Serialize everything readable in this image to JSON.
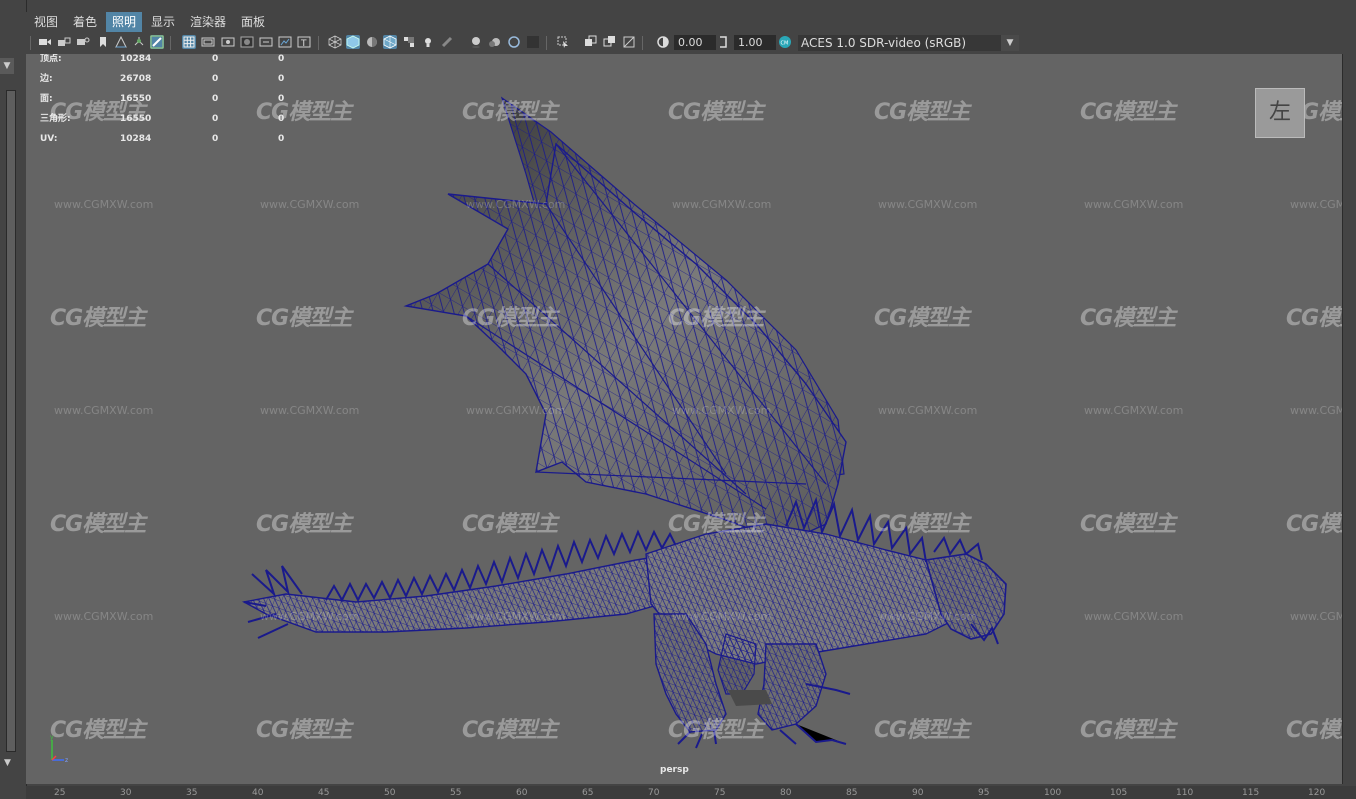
{
  "menu": {
    "items": [
      {
        "label": "视图",
        "active": false
      },
      {
        "label": "着色",
        "active": false
      },
      {
        "label": "照明",
        "active": true
      },
      {
        "label": "显示",
        "active": false
      },
      {
        "label": "渲染器",
        "active": false
      },
      {
        "label": "面板",
        "active": false
      }
    ]
  },
  "toolbar": {
    "exposure_value": "0.00",
    "gamma_value": "1.00",
    "color_space": "ACES 1.0 SDR-video (sRGB)"
  },
  "hud": {
    "rows": [
      {
        "label": "顶点:",
        "v1": "10284",
        "v2": "0",
        "v3": "0"
      },
      {
        "label": "边:",
        "v1": "26708",
        "v2": "0",
        "v3": "0"
      },
      {
        "label": "面:",
        "v1": "16550",
        "v2": "0",
        "v3": "0"
      },
      {
        "label": "三角形:",
        "v1": "16550",
        "v2": "0",
        "v3": "0"
      },
      {
        "label": "UV:",
        "v1": "10284",
        "v2": "0",
        "v3": "0"
      }
    ]
  },
  "viewcube": {
    "label": "左"
  },
  "camera": {
    "label": "persp"
  },
  "watermark": {
    "logo": "CG模型主",
    "url": "www.CGMXW.com"
  },
  "ruler": {
    "ticks": [
      "25",
      "30",
      "35",
      "40",
      "45",
      "50",
      "55",
      "60",
      "65",
      "70",
      "75",
      "80",
      "85",
      "90",
      "95",
      "100",
      "105",
      "110",
      "115",
      "120"
    ]
  },
  "colors": {
    "accent": "#5285a6",
    "viewport_bg": "#646464",
    "wire": "#1a1a8c"
  }
}
